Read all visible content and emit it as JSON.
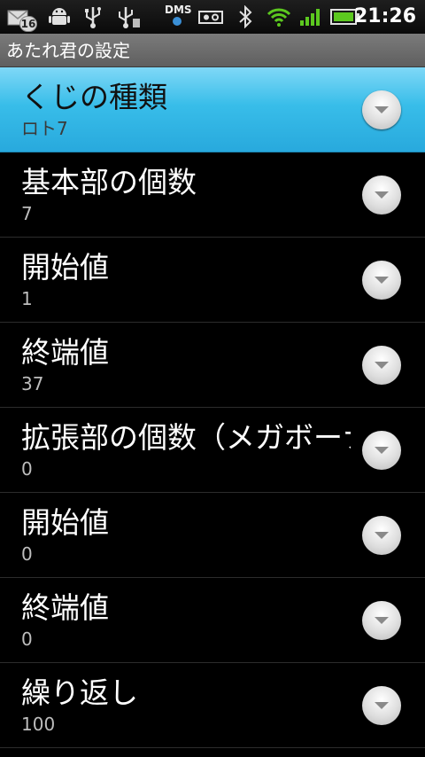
{
  "statusbar": {
    "notification_count": "16",
    "dms_label": "DMS",
    "time": "21:26",
    "icons": [
      "mail-icon",
      "android-icon",
      "usb-icon",
      "usb-icon",
      "dms-icon",
      "camera-icon",
      "bluetooth-icon",
      "wifi-icon",
      "signal-icon",
      "battery-icon"
    ],
    "battery_color": "#3fbf1a"
  },
  "titlebar": {
    "title": "あたれ君の設定"
  },
  "accent_color": "#38bde9",
  "settings": [
    {
      "title": "くじの種類",
      "summary": "ロト7",
      "selected": true
    },
    {
      "title": "基本部の個数",
      "summary": "7"
    },
    {
      "title": "開始値",
      "summary": "1"
    },
    {
      "title": "終端値",
      "summary": "37"
    },
    {
      "title": "拡張部の個数（メガボーナス）",
      "summary": "0"
    },
    {
      "title": "開始値",
      "summary": "0"
    },
    {
      "title": "終端値",
      "summary": "0"
    },
    {
      "title": "繰り返し",
      "summary": "100"
    }
  ]
}
